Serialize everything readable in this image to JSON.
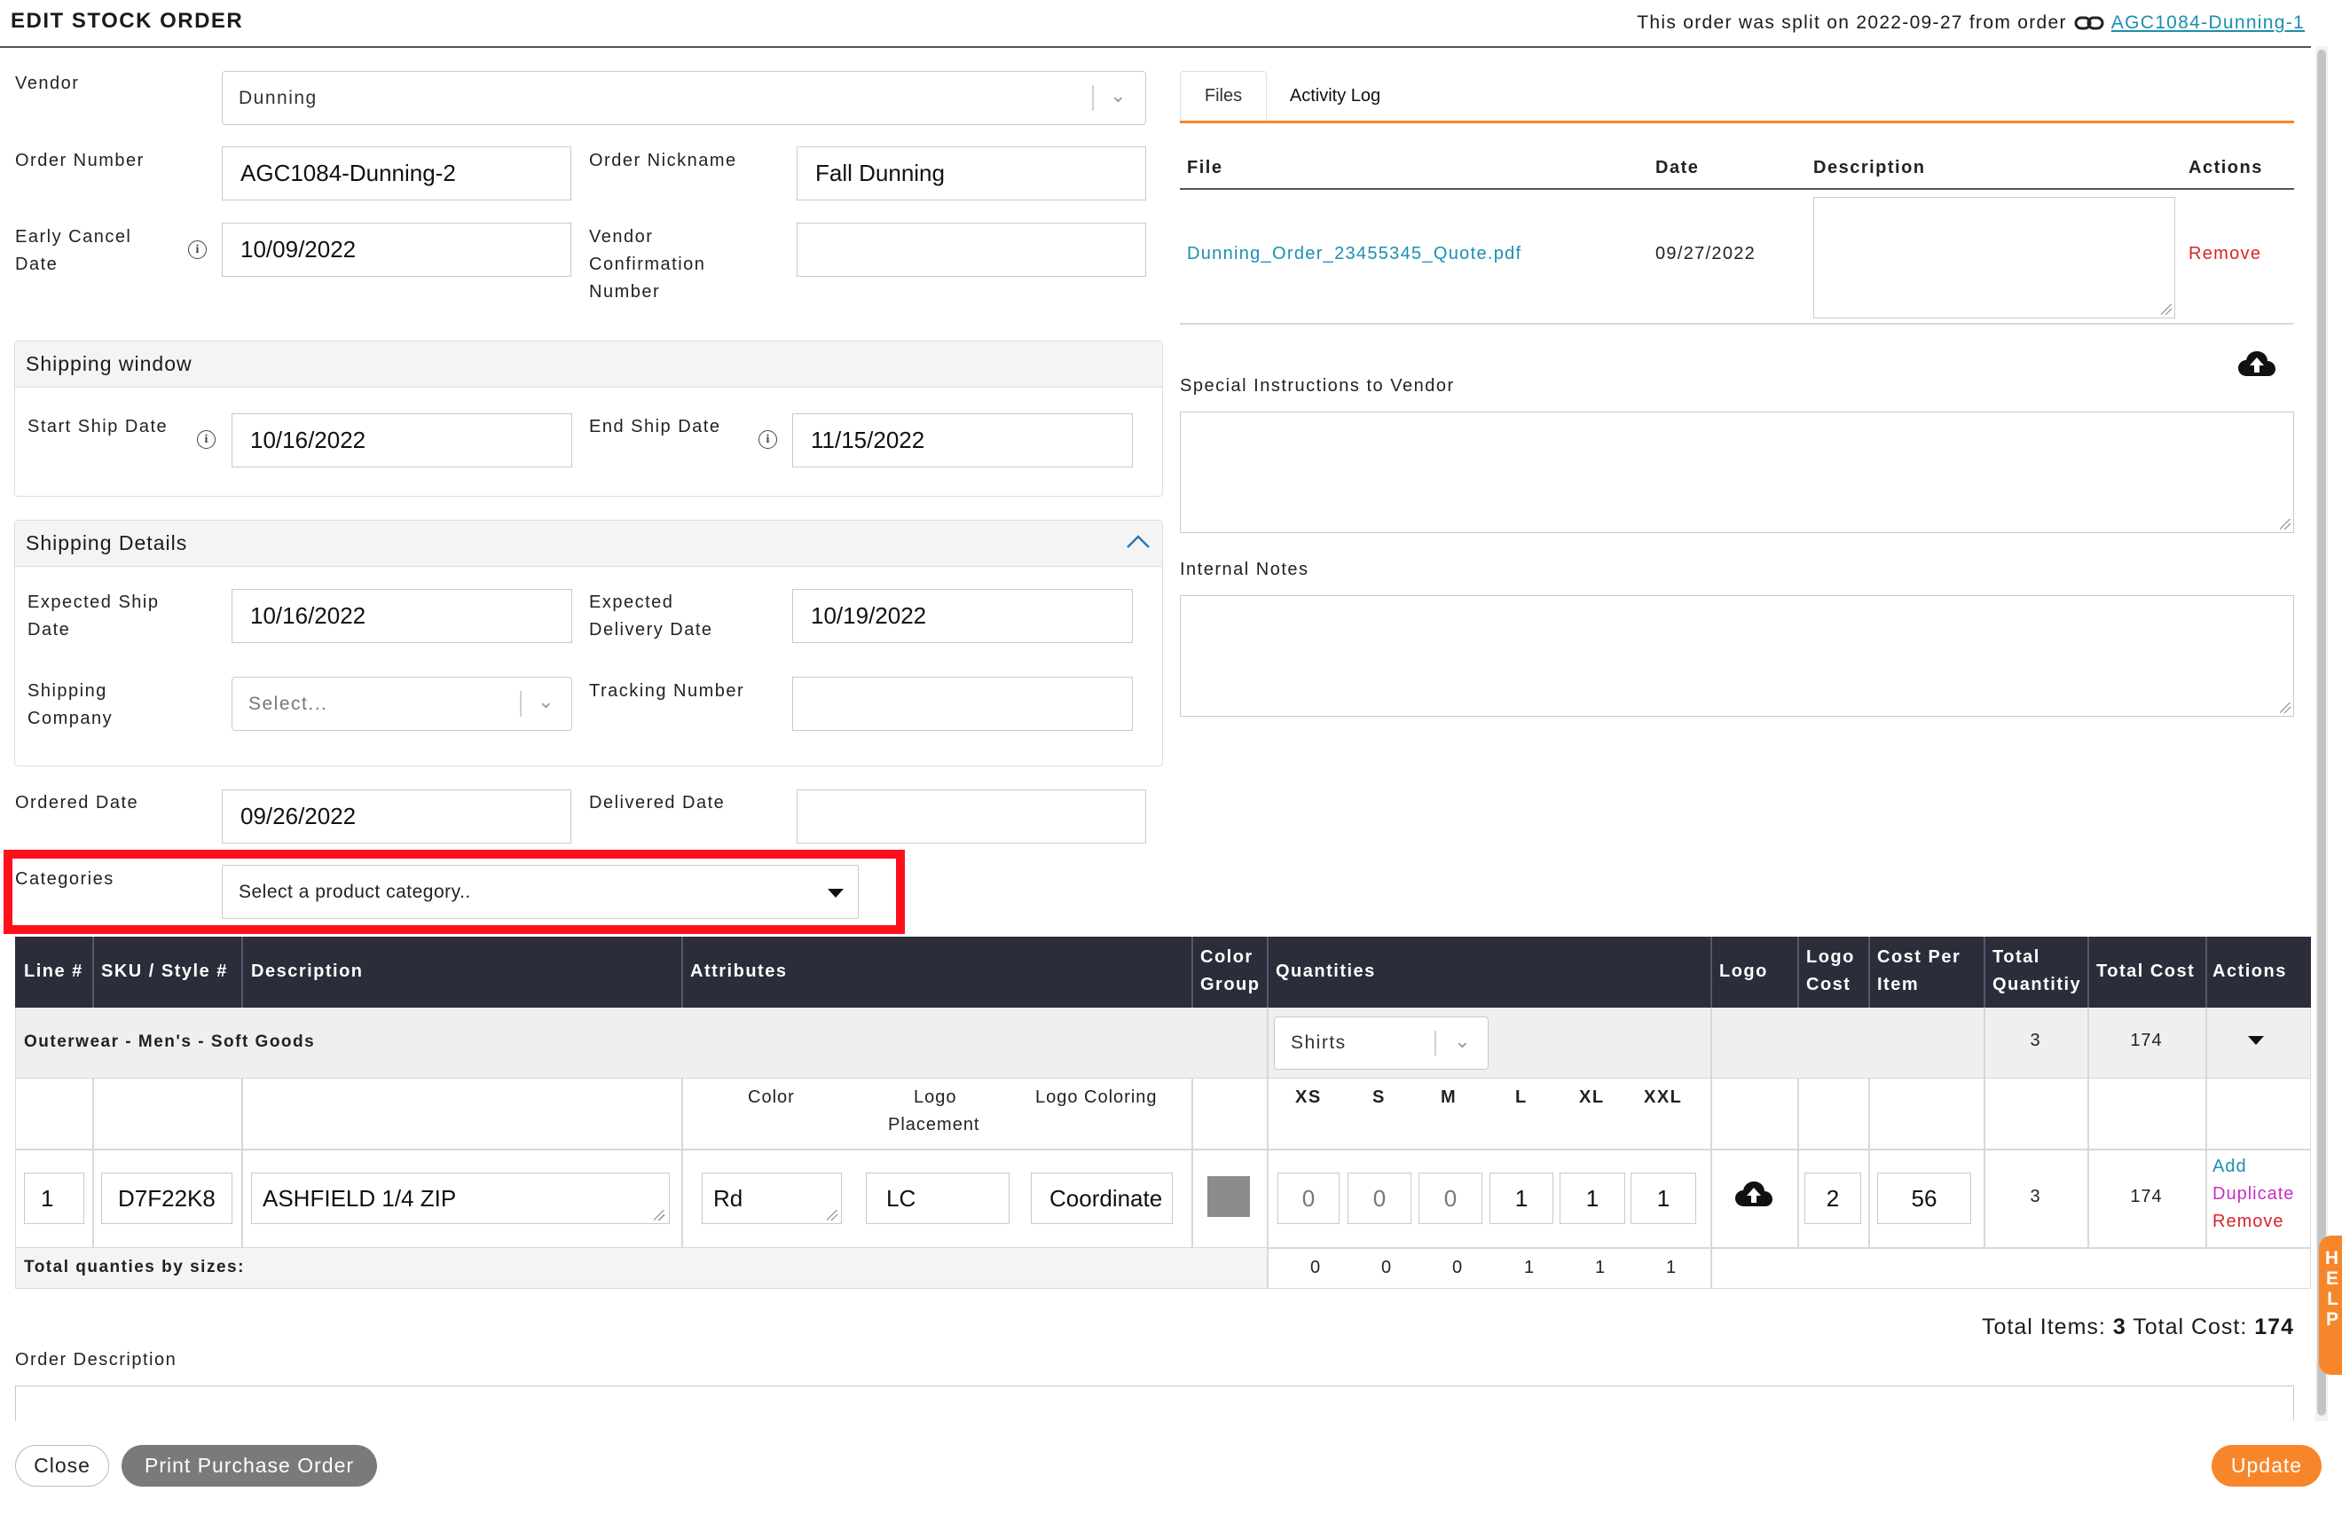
{
  "header": {
    "title": "EDIT STOCK ORDER",
    "split_notice": "This order was split on 2022-09-27 from order",
    "split_link": "AGC1084-Dunning-1"
  },
  "form": {
    "vendor_label": "Vendor",
    "vendor_value": "Dunning",
    "order_number_label": "Order Number",
    "order_number_value": "AGC1084-Dunning-2",
    "order_nickname_label": "Order Nickname",
    "order_nickname_value": "Fall Dunning",
    "early_cancel_label_1": "Early Cancel",
    "early_cancel_label_2": "Date",
    "early_cancel_value": "10/09/2022",
    "vendor_conf_label_1": "Vendor",
    "vendor_conf_label_2": "Confirmation",
    "vendor_conf_label_3": "Number",
    "vendor_conf_value": "",
    "ordered_date_label": "Ordered Date",
    "ordered_date_value": "09/26/2022",
    "delivered_date_label": "Delivered Date",
    "delivered_date_value": "",
    "categories_label": "Categories",
    "categories_placeholder": "Select a product category.."
  },
  "shipping_window": {
    "title": "Shipping window",
    "start_label": "Start Ship Date",
    "start_value": "10/16/2022",
    "end_label": "End Ship Date",
    "end_value": "11/15/2022"
  },
  "shipping_details": {
    "title": "Shipping Details",
    "expected_ship_label_1": "Expected Ship",
    "expected_ship_label_2": "Date",
    "expected_ship_value": "10/16/2022",
    "expected_delivery_label_1": "Expected",
    "expected_delivery_label_2": "Delivery Date",
    "expected_delivery_value": "10/19/2022",
    "shipping_company_label_1": "Shipping",
    "shipping_company_label_2": "Company",
    "shipping_company_placeholder": "Select...",
    "tracking_label": "Tracking Number",
    "tracking_value": ""
  },
  "files": {
    "tabs": [
      "Files",
      "Activity Log"
    ],
    "columns": [
      "File",
      "Date",
      "Description",
      "Actions"
    ],
    "rows": [
      {
        "file": "Dunning_Order_23455345_Quote.pdf",
        "date": "09/27/2022",
        "description": "",
        "action": "Remove"
      }
    ]
  },
  "notes": {
    "special_label": "Special Instructions to Vendor",
    "internal_label": "Internal Notes"
  },
  "table": {
    "headers": {
      "line": "Line #",
      "sku": "SKU / Style #",
      "description": "Description",
      "attributes": "Attributes",
      "color_group_1": "Color",
      "color_group_2": "Group",
      "quantities": "Quantities",
      "logo": "Logo",
      "logo_cost_1": "Logo",
      "logo_cost_2": "Cost",
      "cost_per_item_1": "Cost Per",
      "cost_per_item_2": "Item",
      "total_quantity_1": "Total",
      "total_quantity_2": "Quantitiy",
      "total_cost": "Total Cost",
      "actions": "Actions"
    },
    "group": {
      "name": "Outerwear - Men's - Soft Goods",
      "size_type": "Shirts",
      "total_quantity": "3",
      "total_cost": "174"
    },
    "sub_headers": {
      "color": "Color",
      "logo_placement_1": "Logo",
      "logo_placement_2": "Placement",
      "logo_coloring": "Logo Coloring",
      "sizes": [
        "XS",
        "S",
        "M",
        "L",
        "XL",
        "XXL"
      ]
    },
    "row": {
      "line": "1",
      "sku": "D7F22K8",
      "description": "ASHFIELD 1/4 ZIP",
      "color": "Rd",
      "logo_placement": "LC",
      "logo_coloring": "Coordinate",
      "quantities": [
        "0",
        "0",
        "0",
        "1",
        "1",
        "1"
      ],
      "logo_cost": "2",
      "cost_per_item": "56",
      "total_quantity": "3",
      "total_cost": "174",
      "actions": [
        "Add",
        "Duplicate",
        "Remove"
      ]
    },
    "totals_label": "Total quanties by sizes:",
    "totals_by_size": [
      "0",
      "0",
      "0",
      "1",
      "1",
      "1"
    ]
  },
  "summary": {
    "items_label": "Total Items:",
    "items_value": "3",
    "cost_label": "Total Cost:",
    "cost_value": "174"
  },
  "order_description_label": "Order Description",
  "help_tab": "HELP",
  "buttons": {
    "close": "Close",
    "print": "Print Purchase Order",
    "update": "Update"
  },
  "colors": {
    "accent": "#f7862b",
    "link": "#1a8fb0",
    "danger": "#d9232a",
    "magenta": "#c430c4",
    "table_header": "#2b2d3a",
    "highlight": "#ff0f1a",
    "swatch": "#8c8c8c",
    "print_button": "#7a7a7a"
  }
}
